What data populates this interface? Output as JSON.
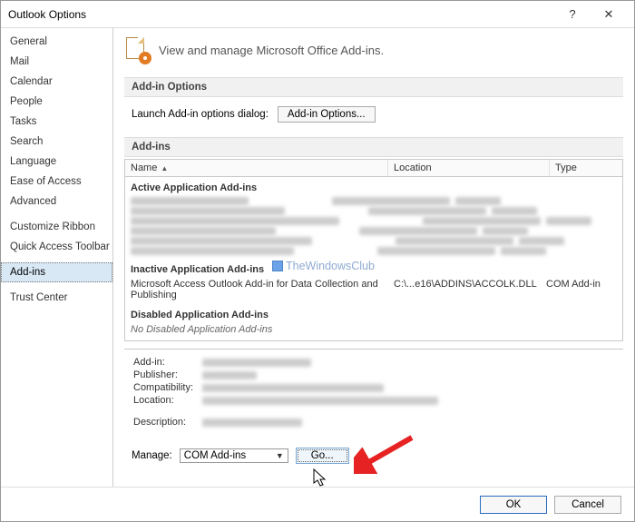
{
  "window": {
    "title": "Outlook Options"
  },
  "sidebar": {
    "items": [
      {
        "label": "General"
      },
      {
        "label": "Mail"
      },
      {
        "label": "Calendar"
      },
      {
        "label": "People"
      },
      {
        "label": "Tasks"
      },
      {
        "label": "Search"
      },
      {
        "label": "Language"
      },
      {
        "label": "Ease of Access"
      },
      {
        "label": "Advanced"
      },
      {
        "label": "Customize Ribbon"
      },
      {
        "label": "Quick Access Toolbar"
      },
      {
        "label": "Add-ins",
        "selected": true
      },
      {
        "label": "Trust Center"
      }
    ]
  },
  "main": {
    "heading": "View and manage Microsoft Office Add-ins.",
    "sections": {
      "options_title": "Add-in Options",
      "launch_label": "Launch Add-in options dialog:",
      "options_button": "Add-in Options...",
      "addins_title": "Add-ins"
    },
    "grid": {
      "columns": {
        "name": "Name",
        "location": "Location",
        "type": "Type"
      },
      "groups": {
        "active": "Active Application Add-ins",
        "inactive": "Inactive Application Add-ins",
        "disabled": "Disabled Application Add-ins",
        "disabled_none": "No Disabled Application Add-ins"
      },
      "inactive_row": {
        "name": "Microsoft Access Outlook Add-in for Data Collection and Publishing",
        "location": "C:\\...e16\\ADDINS\\ACCOLK.DLL",
        "type": "COM Add-in"
      }
    },
    "details": {
      "addin_label": "Add-in:",
      "publisher_label": "Publisher:",
      "compat_label": "Compatibility:",
      "location_label": "Location:",
      "description_label": "Description:"
    },
    "manage": {
      "label": "Manage:",
      "selected": "COM Add-ins",
      "go": "Go..."
    }
  },
  "footer": {
    "ok": "OK",
    "cancel": "Cancel"
  },
  "watermark": "TheWindowsClub"
}
